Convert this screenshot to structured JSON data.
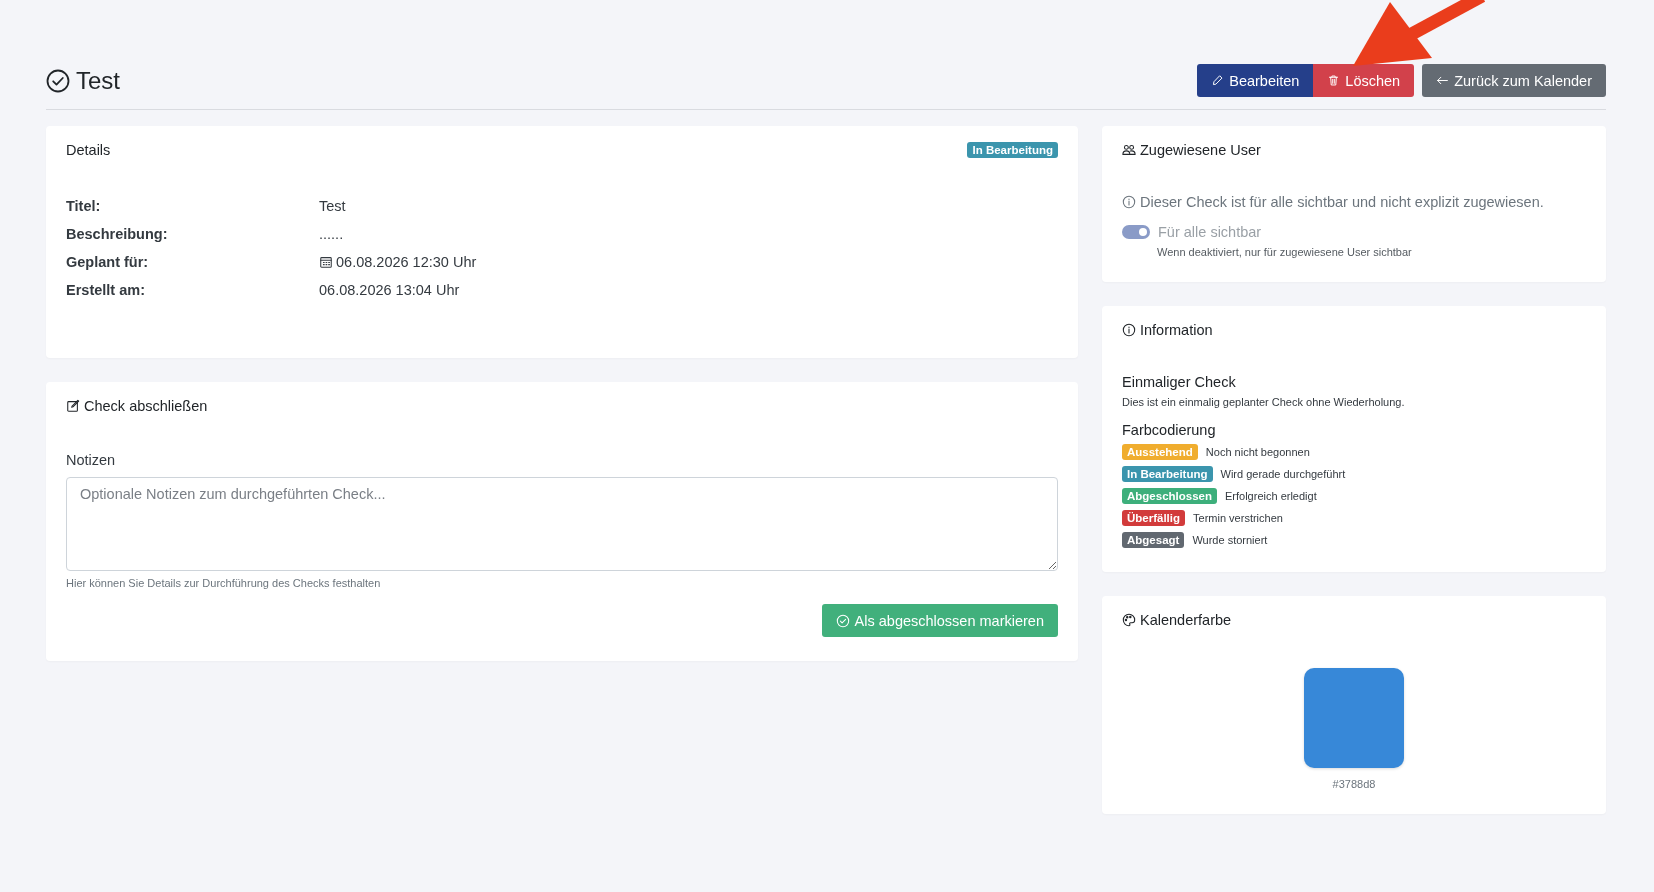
{
  "page_title": "Test",
  "actions": [
    {
      "label": "Bearbeiten",
      "kind": "edit"
    },
    {
      "label": "Löschen",
      "kind": "delete"
    },
    {
      "label": "Zurück zum Kalender",
      "kind": "back"
    }
  ],
  "details": {
    "title": "Details",
    "status": {
      "label": "In Bearbeitung",
      "kind": "in_progress"
    },
    "fields": [
      {
        "label": "Titel:",
        "value": "Test",
        "kind": "text"
      },
      {
        "label": "Beschreibung:",
        "value": "......",
        "kind": "text"
      },
      {
        "label": "Geplant für:",
        "value": "06.08.2026 12:30 Uhr",
        "kind": "date"
      },
      {
        "label": "Erstellt am:",
        "value": "06.08.2026 13:04 Uhr",
        "kind": "text"
      }
    ]
  },
  "complete_check": {
    "title": "Check abschließen",
    "notes_label": "Notizen",
    "placeholder": "Optionale Notizen zum durchgeführten Check...",
    "help": "Hier können Sie Details zur Durchführung des Checks festhalten",
    "submit": "Als abgeschlossen markieren"
  },
  "assigned_users": {
    "title": "Zugewiesene User",
    "info": "Dieser Check ist für alle sichtbar und nicht explizit zugewiesen.",
    "toggle": {
      "label": "Für alle sichtbar",
      "on": true,
      "disabled": true
    },
    "hint": "Wenn deaktiviert, nur für zugewiesene User sichtbar"
  },
  "information": {
    "title": "Information",
    "type_title": "Einmaliger Check",
    "type_text": "Dies ist ein einmalig geplanter Check ohne Wiederholung.",
    "legend_title": "Farbcodierung",
    "legend": [
      {
        "label": "Ausstehend",
        "text": "Noch nicht begonnen",
        "color": "#f0ad2e"
      },
      {
        "label": "In Bearbeitung",
        "text": "Wird gerade durchgeführt",
        "color": "#3b95ad"
      },
      {
        "label": "Abgeschlossen",
        "text": "Erfolgreich erledigt",
        "color": "#3daf7b"
      },
      {
        "label": "Überfällig",
        "text": "Termin verstrichen",
        "color": "#d23b3b"
      },
      {
        "label": "Abgesagt",
        "text": "Wurde storniert",
        "color": "#616870"
      }
    ]
  },
  "calendar_color": {
    "title": "Kalenderfarbe",
    "value": "#3788d8"
  }
}
